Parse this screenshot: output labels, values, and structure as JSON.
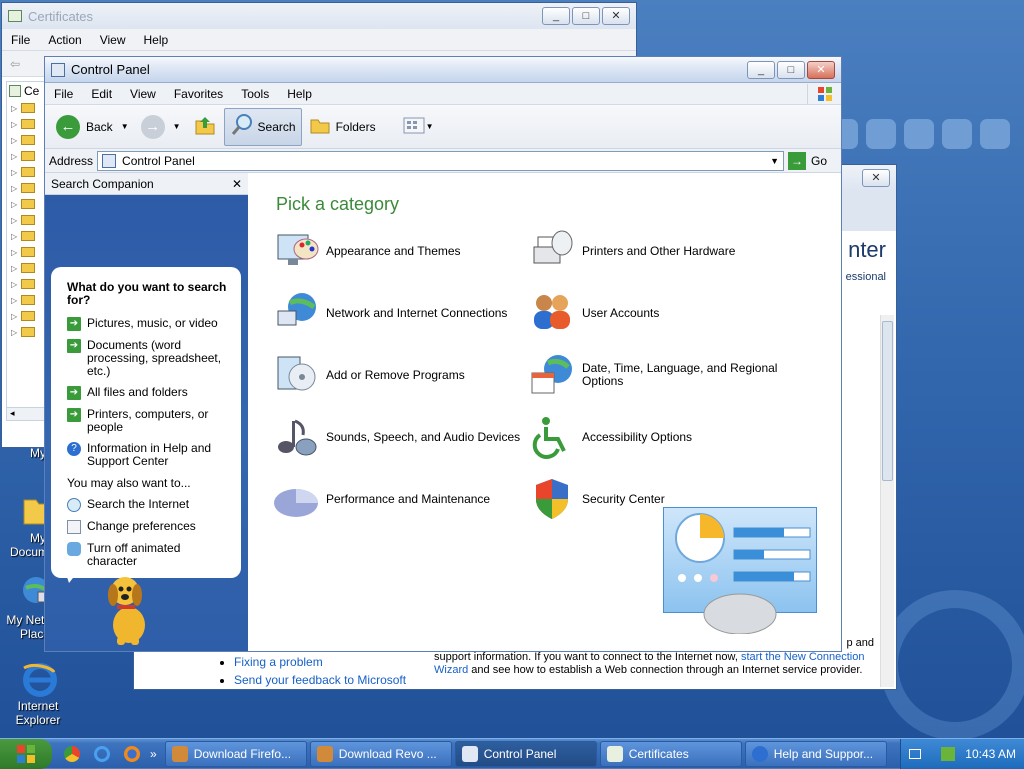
{
  "desktop": {
    "icons": [
      {
        "label": "My"
      },
      {
        "label": "My Documents"
      },
      {
        "label": "My Network Places"
      },
      {
        "label": "Internet Explorer"
      }
    ]
  },
  "certificates": {
    "title": "Certificates",
    "menu": [
      "File",
      "Action",
      "View",
      "Help"
    ],
    "tree_root": "Ce"
  },
  "help": {
    "title_fragment": "nter",
    "subtitle_fragment": "essional",
    "text_right_fragment": "p and",
    "links": [
      "Fixing a problem",
      "Send your feedback to Microsoft"
    ],
    "body_line1": "support information. If you want to connect to the Internet now,",
    "body_link": "start the New Connection Wizard",
    "body_line2": "and see how to establish a Web connection through an Internet service provider."
  },
  "control_panel": {
    "title": "Control Panel",
    "menu": [
      "File",
      "Edit",
      "View",
      "Favorites",
      "Tools",
      "Help"
    ],
    "toolbar": {
      "back": "Back",
      "search": "Search",
      "folders": "Folders"
    },
    "address_label": "Address",
    "address_value": "Control Panel",
    "go_label": "Go",
    "search_companion": {
      "header": "Search Companion",
      "question": "What do you want to search for?",
      "options": [
        "Pictures, music, or video",
        "Documents (word processing, spreadsheet, etc.)",
        "All files and folders",
        "Printers, computers, or people",
        "Information in Help and Support Center"
      ],
      "also_label": "You may also want to...",
      "also_options": [
        "Search the Internet",
        "Change preferences",
        "Turn off animated character"
      ]
    },
    "heading": "Pick a category",
    "categories": [
      "Appearance and Themes",
      "Printers and Other Hardware",
      "Network and Internet Connections",
      "User Accounts",
      "Add or Remove Programs",
      "Date, Time, Language, and Regional Options",
      "Sounds, Speech, and Audio Devices",
      "Accessibility Options",
      "Performance and Maintenance",
      "Security Center"
    ]
  },
  "taskbar": {
    "tasks": [
      "Download Firefo...",
      "Download Revo ...",
      "Control Panel",
      "Certificates",
      "Help and Suppor..."
    ],
    "clock": "10:43 AM",
    "more_glyph": "»"
  },
  "colors": {
    "heading_green": "#3a8a3a",
    "link_blue": "#1660c8",
    "sidebar_blue": "#2d5aa6"
  }
}
